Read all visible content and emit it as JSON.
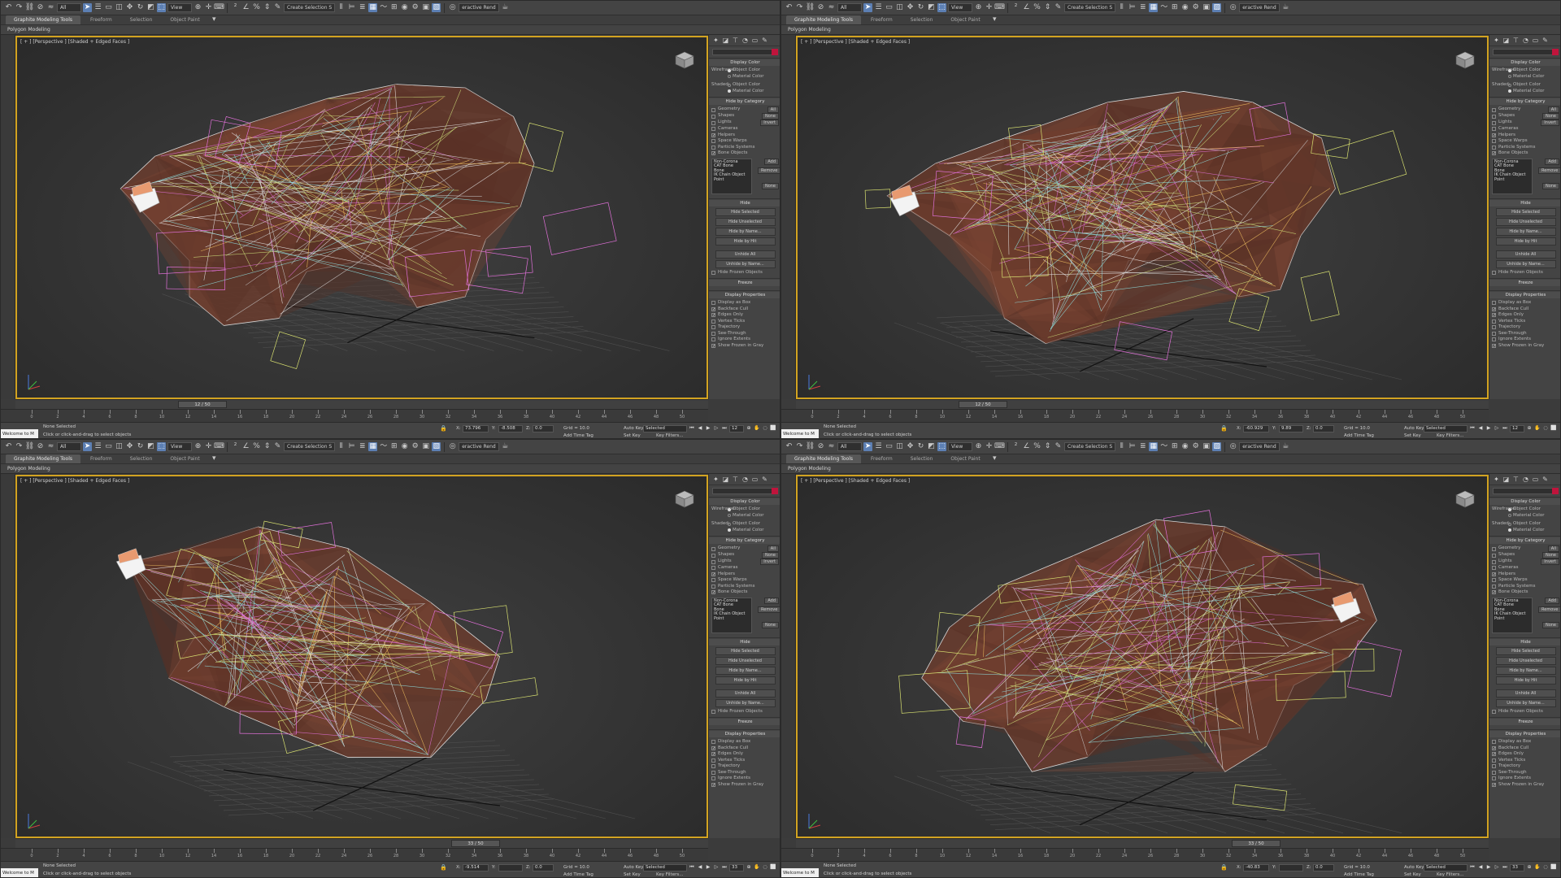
{
  "app": {
    "ribbon_tabs": [
      "Graphite Modeling Tools",
      "Freeform",
      "Selection",
      "Object Paint"
    ],
    "sub_ribbon": "Polygon Modeling",
    "toolbar": {
      "selection_filter": "All",
      "ref_coord": "View",
      "named_sel": "Create Selection S",
      "renderer_label": "eractive Rend"
    }
  },
  "panel": {
    "display_color": {
      "title": "Display Color",
      "wireframe_label": "Wireframe:",
      "shaded_label": "Shaded:",
      "object_color": "Object Color",
      "material_color": "Material Color"
    },
    "hide_by_category": {
      "title": "Hide by Category",
      "items": [
        {
          "label": "Geometry",
          "checked": false,
          "btn": "All"
        },
        {
          "label": "Shapes",
          "checked": false,
          "btn": "None"
        },
        {
          "label": "Lights",
          "checked": false,
          "btn": "Invert"
        },
        {
          "label": "Cameras",
          "checked": false,
          "btn": ""
        },
        {
          "label": "Helpers",
          "checked": true,
          "btn": ""
        },
        {
          "label": "Space Warps",
          "checked": false,
          "btn": ""
        },
        {
          "label": "Particle Systems",
          "checked": false,
          "btn": ""
        },
        {
          "label": "Bone Objects",
          "checked": true,
          "btn": ""
        }
      ],
      "list": [
        "Non-Corona",
        "CAT Bone",
        "Bone",
        "IK Chain Object",
        "Point"
      ],
      "add": "Add",
      "remove": "Remove",
      "none": "None"
    },
    "hide": {
      "title": "Hide",
      "buttons": [
        "Hide Selected",
        "Hide Unselected",
        "Hide by Name...",
        "Hide by Hit",
        "Unhide All",
        "Unhide by Name..."
      ],
      "frozen": "Hide Frozen Objects"
    },
    "freeze": {
      "title": "Freeze"
    },
    "display_properties": {
      "title": "Display Properties",
      "items": [
        {
          "label": "Display as Box",
          "checked": false
        },
        {
          "label": "Backface Cull",
          "checked": true
        },
        {
          "label": "Edges Only",
          "checked": true
        },
        {
          "label": "Vertex Ticks",
          "checked": false
        },
        {
          "label": "Trajectory",
          "checked": false
        },
        {
          "label": "See-Through",
          "checked": false
        },
        {
          "label": "Ignore Extents",
          "checked": false
        },
        {
          "label": "Show Frozen in Gray",
          "checked": true
        }
      ]
    }
  },
  "status": {
    "maxscript": "Welcome to M",
    "line1": "None Selected",
    "line2": "Click or click-and-drag to select objects",
    "grid": "Grid = 10.0",
    "auto_key": "Auto Key",
    "set_key": "Set Key",
    "selected": "Selected",
    "key_filters": "Key Filters...",
    "add_time_tag": "Add Time Tag"
  },
  "timeline": {
    "ticks": [
      "0",
      "2",
      "4",
      "6",
      "8",
      "10",
      "12",
      "14",
      "16",
      "18",
      "20",
      "22",
      "24",
      "26",
      "28",
      "30",
      "32",
      "34",
      "36",
      "38",
      "40",
      "42",
      "44",
      "46",
      "48",
      "50"
    ]
  },
  "viewports": [
    {
      "label": "[ + ] [Perspective ] [Shaded + Edged Faces ]",
      "frame": "12 / 50",
      "frame_pos": 0.24,
      "x": "73.796",
      "y": "-8.508",
      "z": "0.0",
      "cur": "12",
      "view": "side-left"
    },
    {
      "label": "[ + ] [Perspective ] [Shaded + Edged Faces ]",
      "frame": "12 / 50",
      "frame_pos": 0.24,
      "x": "-60.929",
      "y": "9.89",
      "z": "0.0",
      "cur": "12",
      "view": "side-left-2"
    },
    {
      "label": "[ + ] [Perspective ] [Shaded + Edged Faces ]",
      "frame": "33 / 50",
      "frame_pos": 0.66,
      "x": "-9.514",
      "y": "",
      "z": "0.0",
      "cur": "33",
      "view": "top"
    },
    {
      "label": "[ + ] [Perspective ] [Shaded + Edged Faces ]",
      "frame": "33 / 50",
      "frame_pos": 0.66,
      "x": "-40.83",
      "y": "",
      "z": "0.0",
      "cur": "33",
      "view": "side-right"
    }
  ]
}
